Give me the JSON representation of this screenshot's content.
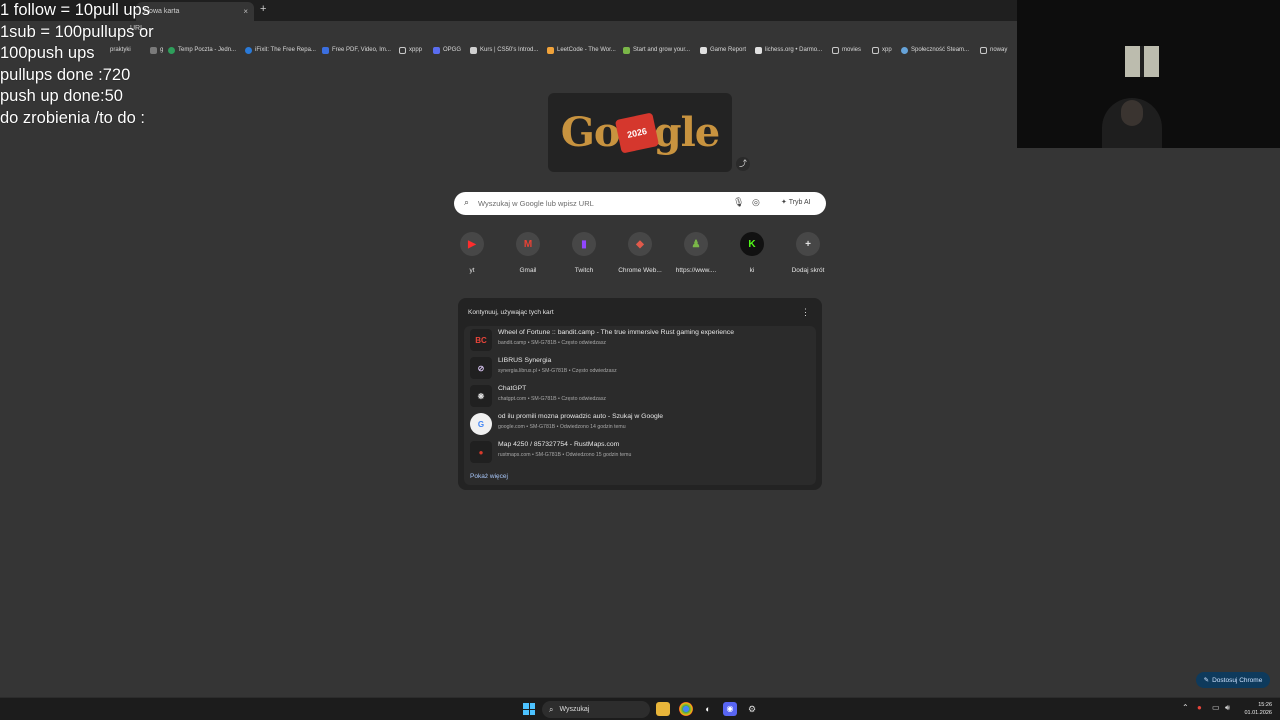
{
  "overlay": {
    "lines": [
      "1 follow = 10pull ups",
      "1sub = 100pullups or",
      "100push ups",
      "pullups done :720",
      "push up done:50",
      "do zrobienia /to do :"
    ]
  },
  "tabs": {
    "active_label": "Nowa karta",
    "close_glyph": "×",
    "new_tab_glyph": "+"
  },
  "toolbar": {
    "url_text": "URL"
  },
  "bookmarks": [
    {
      "label": "praktyki",
      "color": "#7a7a7a"
    },
    {
      "label": "g",
      "color": "#7a7a7a"
    },
    {
      "label": "Temp Poczta - Jedn...",
      "color": "#2e9e5b"
    },
    {
      "label": "iFixit: The Free Repa...",
      "color": "#2a7ad8"
    },
    {
      "label": "Free PDF, Video, Im...",
      "color": "#3b6fe0"
    },
    {
      "label": "xppp",
      "color": "#c9c9c9"
    },
    {
      "label": "OPGG",
      "color": "#5a6df0"
    },
    {
      "label": "Kurs | CS50's Introd...",
      "color": "#d0d0d0"
    },
    {
      "label": "LeetCode - The Wor...",
      "color": "#f1a33a"
    },
    {
      "label": "Start and grow your...",
      "color": "#7ab648"
    },
    {
      "label": "Game Report",
      "color": "#e0e0e0"
    },
    {
      "label": "lichess.org • Darmo...",
      "color": "#e0e0e0"
    },
    {
      "label": "movies",
      "color": "#c9c9c9"
    },
    {
      "label": "xpp",
      "color": "#c9c9c9"
    },
    {
      "label": "Społeczność Steam...",
      "color": "#66a3d9"
    },
    {
      "label": "noway",
      "color": "#c9c9c9"
    }
  ],
  "doodle": {
    "text_left": "G",
    "text_o": "o",
    "badge": "2026",
    "text_right": "gle",
    "share_glyph": "⤴"
  },
  "search": {
    "placeholder": "Wyszukaj w Google lub wpisz URL",
    "value": "",
    "ai_label": "Tryb AI"
  },
  "shortcuts": [
    {
      "label": "yt",
      "glyph": "▶",
      "color": "#ff2d2d"
    },
    {
      "label": "Gmail",
      "glyph": "M",
      "color": "#e94235"
    },
    {
      "label": "Twitch",
      "glyph": "▮",
      "color": "#9146ff"
    },
    {
      "label": "Chrome Web...",
      "glyph": "◆",
      "color": "#e15a4b"
    },
    {
      "label": "https://www....",
      "glyph": "♟",
      "color": "#7ab648"
    },
    {
      "label": "ki",
      "glyph": "K",
      "color": "#53fc18"
    },
    {
      "label": "Dodaj skrót",
      "glyph": "+",
      "color": "#e3e3e3"
    }
  ],
  "continue_card": {
    "header": "Kontynuuj, używając tych kart",
    "menu_glyph": "⋮",
    "more_label": "Pokaż więcej",
    "items": [
      {
        "title": "Wheel of Fortune :: bandit.camp - The true immersive Rust gaming experience",
        "sub": "bandit.camp • SM-G781B • Często odwiedzasz",
        "glyph": "BC",
        "color": "#e8443a"
      },
      {
        "title": "LIBRUS Synergia",
        "sub": "synergia.librus.pl • SM-G781B • Często odwiedzasz",
        "glyph": "⊘",
        "color": "#d7c3f0"
      },
      {
        "title": "ChatGPT",
        "sub": "chatgpt.com • SM-G781B • Często odwiedzasz",
        "glyph": "❋",
        "color": "#e0e0e0"
      },
      {
        "title": "od ilu promili mozna prowadzic auto - Szukaj w Google",
        "sub": "google.com • SM-G781B • Odwiedzono 14 godzin temu",
        "glyph": "G",
        "color": "#4285f4"
      },
      {
        "title": "Map 4250 / 857327754 - RustMaps.com",
        "sub": "rustmaps.com • SM-G781B • Odwiedzono 15 godzin temu",
        "glyph": "●",
        "color": "#d93a2b"
      }
    ]
  },
  "customize": {
    "label": "Dostosuj Chrome",
    "glyph": "✎"
  },
  "taskbar": {
    "search_label": "Wyszukaj",
    "time": "15:26",
    "date": "01.01.2026"
  }
}
